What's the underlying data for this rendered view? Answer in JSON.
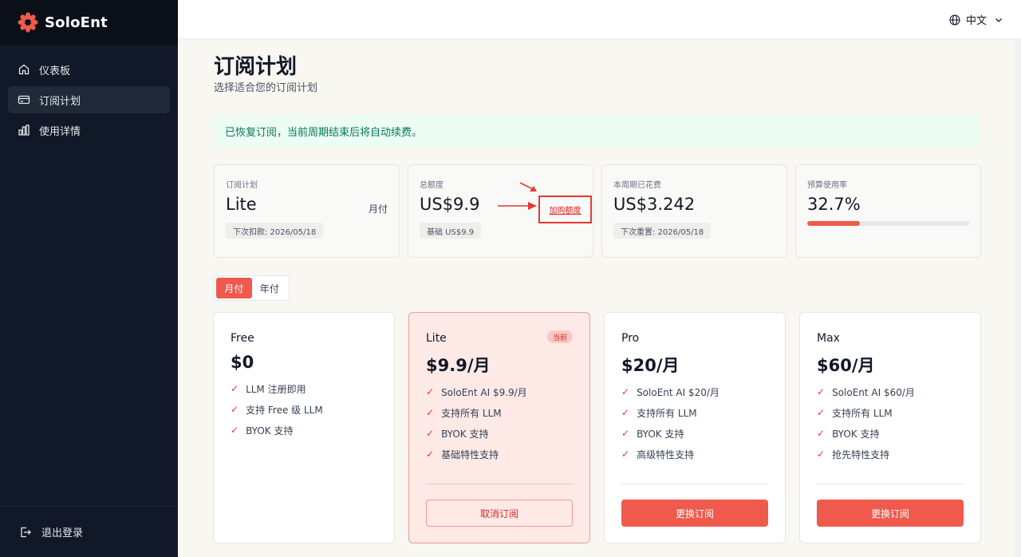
{
  "brand": {
    "name": "SoloEnt"
  },
  "sidebar": {
    "items": [
      {
        "label": "仪表板",
        "icon": "home-icon"
      },
      {
        "label": "订阅计划",
        "icon": "card-icon"
      },
      {
        "label": "使用详情",
        "icon": "bar-chart-icon"
      }
    ],
    "logout_label": "退出登录"
  },
  "topbar": {
    "language": "中文"
  },
  "page": {
    "title": "订阅计划",
    "subtitle": "选择适合您的订阅计划",
    "alert": "已恢复订阅，当前周期结束后将自动续费。"
  },
  "stats": {
    "plan": {
      "label": "订阅计划",
      "value": "Lite",
      "side": "月付",
      "chip": "下次扣款: 2026/05/18"
    },
    "quota": {
      "label": "总额度",
      "value": "US$9.9",
      "chip": "基础 US$9.9",
      "buy_label": "加购额度"
    },
    "spent": {
      "label": "本周期已花费",
      "value": "US$3.242",
      "chip": "下次重置: 2026/05/18"
    },
    "budget": {
      "label": "预算使用率",
      "value": "32.7%",
      "progress_percent": 32.7
    }
  },
  "billing_toggle": {
    "monthly": "月付",
    "yearly": "年付",
    "selected": "月付"
  },
  "plans": [
    {
      "name": "Free",
      "price": "$0",
      "features": [
        "LLM 注册即用",
        "支持 Free 级 LLM",
        "BYOK 支持"
      ]
    },
    {
      "name": "Lite",
      "price": "$9.9/月",
      "badge": "当前",
      "features": [
        "SoloEnt AI $9.9/月",
        "支持所有 LLM",
        "BYOK 支持",
        "基础特性支持"
      ],
      "button": "取消订阅"
    },
    {
      "name": "Pro",
      "price": "$20/月",
      "features": [
        "SoloEnt AI $20/月",
        "支持所有 LLM",
        "BYOK 支持",
        "高级特性支持"
      ],
      "button": "更换订阅"
    },
    {
      "name": "Max",
      "price": "$60/月",
      "features": [
        "SoloEnt AI $60/月",
        "支持所有 LLM",
        "BYOK 支持",
        "抢先特性支持"
      ],
      "button": "更换订阅"
    }
  ],
  "colors": {
    "accent": "#ef5a4c",
    "sidebar": "#111827",
    "success_text": "#047857",
    "success_bg": "#ecfdf3"
  }
}
